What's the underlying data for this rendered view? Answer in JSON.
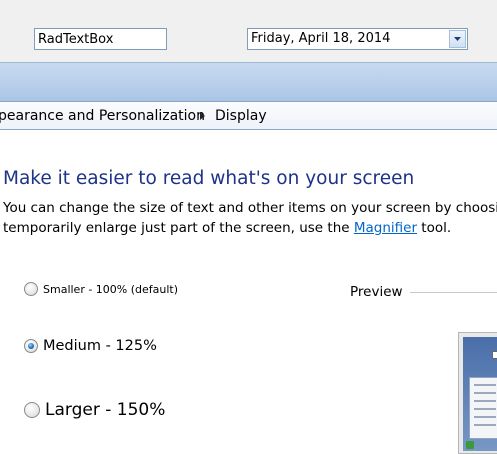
{
  "demo": {
    "textbox_value": "RadTextBox",
    "date_value": "Friday, April 18, 2014"
  },
  "breadcrumb": {
    "items": [
      "pearance and Personalization",
      "Display"
    ]
  },
  "content": {
    "title": "Make it easier to read what's on your screen",
    "desc_line1": "You can change the size of text and other items on your screen by choosing",
    "desc_line2_before": "temporarily enlarge just part of the screen, use the ",
    "desc_link": "Magnifier",
    "desc_line2_after": " tool."
  },
  "options": [
    {
      "label": "Smaller - 100% (default)",
      "checked": false
    },
    {
      "label": "Medium - 125%",
      "checked": true
    },
    {
      "label": "Larger - 150%",
      "checked": false
    }
  ],
  "preview": {
    "label": "Preview"
  },
  "colors": {
    "title": "#1e3287",
    "link": "#0066cc",
    "chrome": "#b9d0eb"
  },
  "icons": {
    "dropdown": "chevron-down-icon",
    "breadcrumb_separator": "triangle-right-icon"
  }
}
